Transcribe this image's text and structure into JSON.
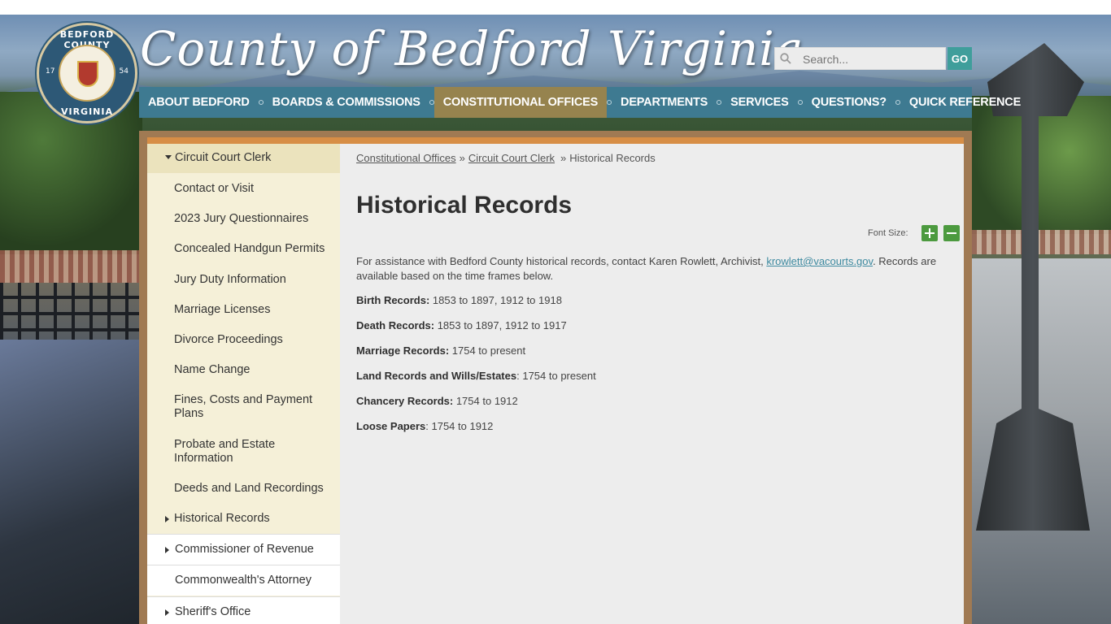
{
  "header": {
    "site_title": "County of Bedford Virginia",
    "seal": {
      "top_text": "BEDFORD COUNTY",
      "bottom_text": "VIRGINIA",
      "year_left": "17",
      "year_right": "54"
    },
    "search": {
      "placeholder": "Search...",
      "go_label": "GO"
    }
  },
  "nav": {
    "items": [
      {
        "label": "About Bedford"
      },
      {
        "label": "Boards & Commissions"
      },
      {
        "label": "Constitutional Offices",
        "active": true
      },
      {
        "label": "Departments"
      },
      {
        "label": "Services"
      },
      {
        "label": "Questions?"
      },
      {
        "label": "Quick Reference"
      }
    ]
  },
  "sidebar": {
    "section_label": "Circuit Court Clerk",
    "subitems": [
      "Contact or Visit",
      "2023 Jury Questionnaires",
      "Concealed Handgun Permits",
      "Jury Duty Information",
      "Marriage Licenses",
      "Divorce Proceedings",
      "Name Change",
      "Fines, Costs and Payment Plans",
      "Probate and Estate Information",
      "Deeds and Land Recordings",
      "Historical Records"
    ],
    "top_items": [
      "Commissioner of Revenue",
      "Commonwealth's Attorney",
      "Sheriff's Office"
    ]
  },
  "breadcrumb": {
    "items": [
      "Constitutional Offices",
      "Circuit Court Clerk"
    ],
    "separator": "»",
    "current": "Historical Records"
  },
  "page": {
    "title": "Historical Records",
    "font_size_label": "Font Size:",
    "intro_before": "For assistance with Bedford County historical records, contact Karen Rowlett, Archivist, ",
    "intro_email": "krowlett@vacourts.gov",
    "intro_after": ". Records are available based on the time frames below.",
    "records": [
      {
        "label": "Birth Records:",
        "value": " 1853 to 1897, 1912 to 1918"
      },
      {
        "label": "Death Records:",
        "value": " 1853 to 1897, 1912 to 1917"
      },
      {
        "label": "Marriage Records:",
        "value": " 1754 to present"
      },
      {
        "label": "Land Records and Wills/Estates",
        "value": ": 1754 to present"
      },
      {
        "label": "Chancery Records:",
        "value": " 1754 to 1912"
      },
      {
        "label": "Loose Papers",
        "value": ": 1754 to 1912"
      }
    ]
  },
  "colors": {
    "nav_bg": "#3e7a91",
    "nav_active": "#96834e",
    "go_button": "#3f9e9b",
    "font_size_buttons": "#4c9a3f",
    "frame": "#a07a53",
    "accent_bar": "#d78e46",
    "sidebar_bg": "#f5f0d8",
    "link": "#3e8aa0"
  }
}
